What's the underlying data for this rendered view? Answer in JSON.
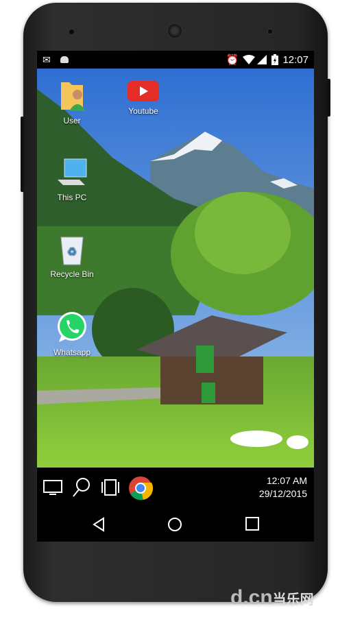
{
  "status_bar": {
    "time": "12:07",
    "left_icons": [
      "gmail-icon",
      "android-icon"
    ],
    "right_icons": [
      "alarm-icon",
      "wifi-icon",
      "signal-icon",
      "battery-charging-icon"
    ]
  },
  "desktop": {
    "icons": [
      {
        "label": "User",
        "icon": "user-folder-icon"
      },
      {
        "label": "Youtube",
        "icon": "youtube-icon"
      },
      {
        "label": "This PC",
        "icon": "computer-icon"
      },
      {
        "label": "Recycle Bin",
        "icon": "recycle-bin-icon"
      },
      {
        "label": "Whatsapp",
        "icon": "whatsapp-icon"
      }
    ]
  },
  "taskbar": {
    "icons": [
      "desktop-icon",
      "search-icon",
      "recent-apps-icon",
      "chrome-icon"
    ],
    "clock_time": "12:07 AM",
    "clock_date": "29/12/2015"
  },
  "nav": {
    "buttons": [
      "back",
      "home",
      "recents"
    ]
  },
  "watermark": {
    "text": "d.cn",
    "cn": "当乐网"
  },
  "colors": {
    "youtube": "#e52d27",
    "whatsapp": "#25d366",
    "sky": "#3d7fd8",
    "grass": "#7cc23a"
  }
}
